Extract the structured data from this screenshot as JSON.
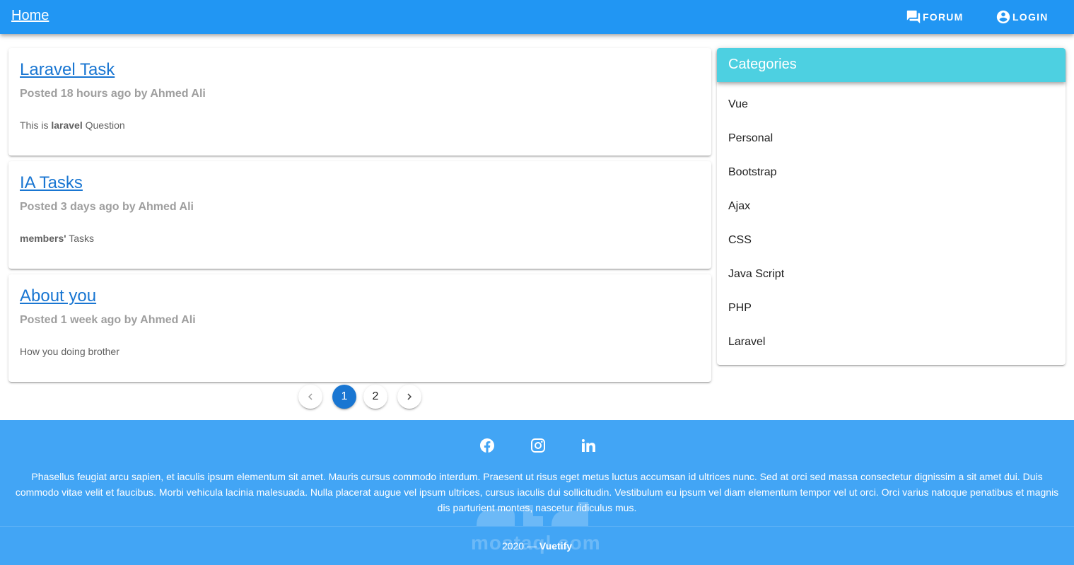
{
  "toolbar": {
    "home_label": "Home",
    "forum_label": "FORUM",
    "login_label": "LOGIN",
    "color": "#2196f3"
  },
  "posts": [
    {
      "title": "Laravel Task",
      "meta": "Posted 18 hours ago by Ahmed Ali",
      "text_before": "This is ",
      "text_bold": "laravel",
      "text_after": " Question"
    },
    {
      "title": "IA Tasks",
      "meta": "Posted 3 days ago by Ahmed Ali",
      "text_before": "",
      "text_bold": "members'",
      "text_after": " Tasks"
    },
    {
      "title": "About you",
      "meta": "Posted 1 week ago by Ahmed Ali",
      "text_before": "How you doing brother",
      "text_bold": "",
      "text_after": ""
    }
  ],
  "pagination": {
    "pages": [
      "1",
      "2"
    ],
    "current": "1",
    "prev_icon": "chevron-left-icon",
    "next_icon": "chevron-right-icon"
  },
  "categories": {
    "title": "Categories",
    "header_color": "#4dd0e1",
    "items": [
      "Vue",
      "Personal",
      "Bootstrap",
      "Ajax",
      "CSS",
      "Java Script",
      "PHP",
      "Laravel"
    ]
  },
  "footer": {
    "color": "#42a5f5",
    "social_icons": [
      "facebook-icon",
      "instagram-icon",
      "linkedin-icon"
    ],
    "text": "Phasellus feugiat arcu sapien, et iaculis ipsum elementum sit amet. Mauris cursus commodo interdum. Praesent ut risus eget metus luctus accumsan id ultrices nunc. Sed at orci sed massa consectetur dignissim a sit amet dui. Duis commodo vitae velit et faucibus. Morbi vehicula lacinia malesuada. Nulla placerat augue vel ipsum ultrices, cursus iaculis dui sollicitudin. Vestibulum eu ipsum vel diam elementum tempor vel ut orci. Orci varius natoque penatibus et magnis dis parturient montes, nascetur ridiculus mus.",
    "copyright_year": "2020 — ",
    "copyright_brand": "Vuetify"
  },
  "watermark": {
    "text": "mostaql.com"
  }
}
